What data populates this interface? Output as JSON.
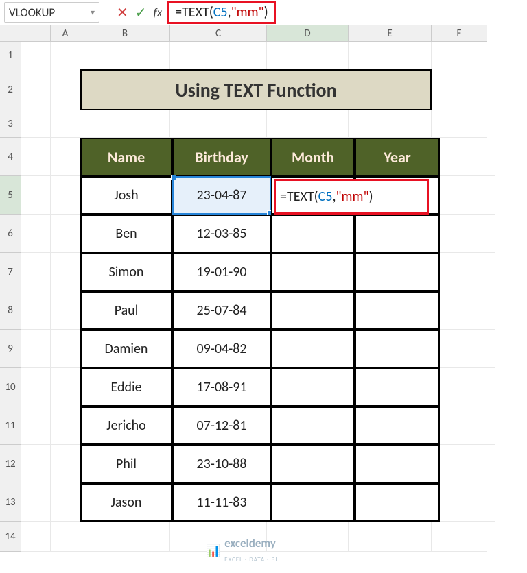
{
  "nameBox": {
    "value": "VLOOKUP"
  },
  "formulaBar": {
    "prefix": "=TEXT(",
    "ref": "C5",
    "mid": ",",
    "str": "\"mm\"",
    "suffix": ")"
  },
  "colHeaders": [
    "A",
    "B",
    "C",
    "D",
    "E",
    "F"
  ],
  "rowHeaders": [
    "1",
    "2",
    "3",
    "4",
    "5",
    "6",
    "7",
    "8",
    "9",
    "10",
    "11",
    "12",
    "13",
    "14"
  ],
  "title": "Using TEXT Function",
  "headers": {
    "name": "Name",
    "birthday": "Birthday",
    "month": "Month",
    "year": "Year"
  },
  "cellFormula": {
    "prefix": "=TEXT(",
    "ref": "C5",
    "mid": ",",
    "str": "\"mm\"",
    "suffix": ")"
  },
  "rows": [
    {
      "name": "Josh",
      "birthday": "23-04-87"
    },
    {
      "name": "Ben",
      "birthday": "12-03-85"
    },
    {
      "name": "Simon",
      "birthday": "19-01-90"
    },
    {
      "name": "Paul",
      "birthday": "25-07-84"
    },
    {
      "name": "Damien",
      "birthday": "09-04-82"
    },
    {
      "name": "Eddie",
      "birthday": "17-08-91"
    },
    {
      "name": "Jericho",
      "birthday": "07-12-81"
    },
    {
      "name": "Phil",
      "birthday": "23-10-88"
    },
    {
      "name": "Jason",
      "birthday": "11-11-83"
    }
  ],
  "watermark": {
    "brand": "exceldemy",
    "tag": "EXCEL · DATA · BI"
  },
  "chart_data": {
    "type": "table",
    "title": "Using TEXT Function",
    "columns": [
      "Name",
      "Birthday",
      "Month",
      "Year"
    ],
    "data": [
      [
        "Josh",
        "23-04-87",
        "",
        ""
      ],
      [
        "Ben",
        "12-03-85",
        "",
        ""
      ],
      [
        "Simon",
        "19-01-90",
        "",
        ""
      ],
      [
        "Paul",
        "25-07-84",
        "",
        ""
      ],
      [
        "Damien",
        "09-04-82",
        "",
        ""
      ],
      [
        "Eddie",
        "17-08-91",
        "",
        ""
      ],
      [
        "Jericho",
        "07-12-81",
        "",
        ""
      ],
      [
        "Phil",
        "23-10-88",
        "",
        ""
      ],
      [
        "Jason",
        "11-11-83",
        "",
        ""
      ]
    ],
    "active_formula": "=TEXT(C5,\"mm\")",
    "active_cell": "D5"
  }
}
